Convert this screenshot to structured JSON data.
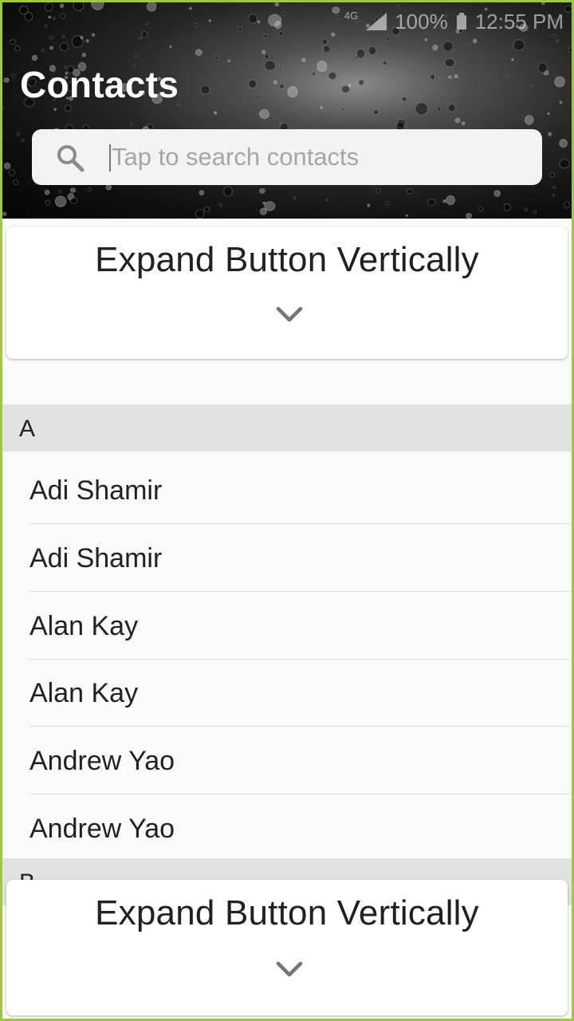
{
  "status_bar": {
    "network": "4G",
    "battery": "100%",
    "time": "12:55 PM"
  },
  "header": {
    "title": "Contacts"
  },
  "search": {
    "placeholder": "Tap to search contacts",
    "value": ""
  },
  "expand_buttons": {
    "top_label": "Expand Button Vertically",
    "bottom_label": "Expand Button Vertically"
  },
  "sections": [
    {
      "letter": "A",
      "contacts": [
        "Adi Shamir",
        "Adi Shamir",
        "Alan Kay",
        "Alan Kay",
        "Andrew Yao",
        "Andrew Yao"
      ]
    },
    {
      "letter": "B",
      "contacts": []
    }
  ],
  "colors": {
    "frame_border": "#9ec93a",
    "section_header_bg": "#e2e2e2",
    "list_bg": "#fafafa",
    "text": "#212121",
    "chevron": "#757575"
  },
  "icons": {
    "search": "search-icon",
    "expand": "chevron-down-icon",
    "signal": "signal-icon",
    "battery": "battery-icon"
  }
}
